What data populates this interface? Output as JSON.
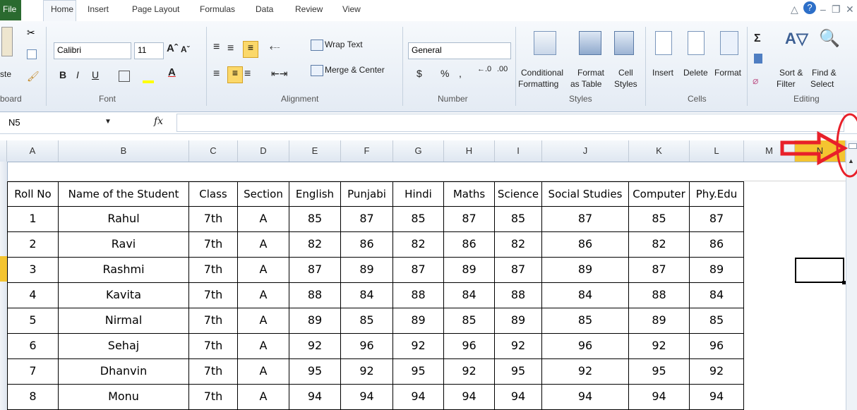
{
  "tabs": [
    "File",
    "Home",
    "Insert",
    "Page Layout",
    "Formulas",
    "Data",
    "Review",
    "View"
  ],
  "ribbon": {
    "clipboard": {
      "paste": "ste",
      "label": "board"
    },
    "font": {
      "name": "Calibri",
      "size": "11",
      "label": "Font",
      "bold": "B",
      "italic": "I",
      "underline": "U"
    },
    "alignment": {
      "wrap": "Wrap Text",
      "merge": "Merge & Center",
      "label": "Alignment"
    },
    "number": {
      "format": "General",
      "currency": "$",
      "percent": "%",
      "comma": ",",
      "label": "Number"
    },
    "styles": {
      "conditional": "Conditional",
      "conditional2": "Formatting",
      "format_table": "Format",
      "format_table2": "as Table",
      "cell": "Cell",
      "cell2": "Styles",
      "label": "Styles"
    },
    "cells": {
      "insert": "Insert",
      "delete": "Delete",
      "format": "Format",
      "label": "Cells"
    },
    "editing": {
      "sort": "Sort &",
      "sort2": "Filter",
      "find": "Find &",
      "find2": "Select",
      "label": "Editing"
    }
  },
  "formula_bar": {
    "name_box": "N5",
    "fx": "fx",
    "value": ""
  },
  "columns": [
    "A",
    "B",
    "C",
    "D",
    "E",
    "F",
    "G",
    "H",
    "I",
    "J",
    "K",
    "L",
    "M",
    "N"
  ],
  "table": {
    "headers": [
      "Roll No",
      "Name of the Student",
      "Class",
      "Section",
      "English",
      "Punjabi",
      "Hindi",
      "Maths",
      "Science",
      "Social Studies",
      "Computer",
      "Phy.Edu"
    ],
    "rows": [
      [
        "1",
        "Rahul",
        "7th",
        "A",
        "85",
        "87",
        "85",
        "87",
        "85",
        "87",
        "85",
        "87"
      ],
      [
        "2",
        "Ravi",
        "7th",
        "A",
        "82",
        "86",
        "82",
        "86",
        "82",
        "86",
        "82",
        "86"
      ],
      [
        "3",
        "Rashmi",
        "7th",
        "A",
        "87",
        "89",
        "87",
        "89",
        "87",
        "89",
        "87",
        "89"
      ],
      [
        "4",
        "Kavita",
        "7th",
        "A",
        "88",
        "84",
        "88",
        "84",
        "88",
        "84",
        "88",
        "84"
      ],
      [
        "5",
        "Nirmal",
        "7th",
        "A",
        "89",
        "85",
        "89",
        "85",
        "89",
        "85",
        "89",
        "85"
      ],
      [
        "6",
        "Sehaj",
        "7th",
        "A",
        "92",
        "96",
        "92",
        "96",
        "92",
        "96",
        "92",
        "96"
      ],
      [
        "7",
        "Dhanvin",
        "7th",
        "A",
        "95",
        "92",
        "95",
        "92",
        "95",
        "92",
        "95",
        "92"
      ],
      [
        "8",
        "Monu",
        "7th",
        "A",
        "94",
        "94",
        "94",
        "94",
        "94",
        "94",
        "94",
        "94"
      ]
    ]
  },
  "colors": {
    "file_tab": "#2a6a2f",
    "annotation": "#e8202a",
    "selected_col": "#f4c430"
  }
}
